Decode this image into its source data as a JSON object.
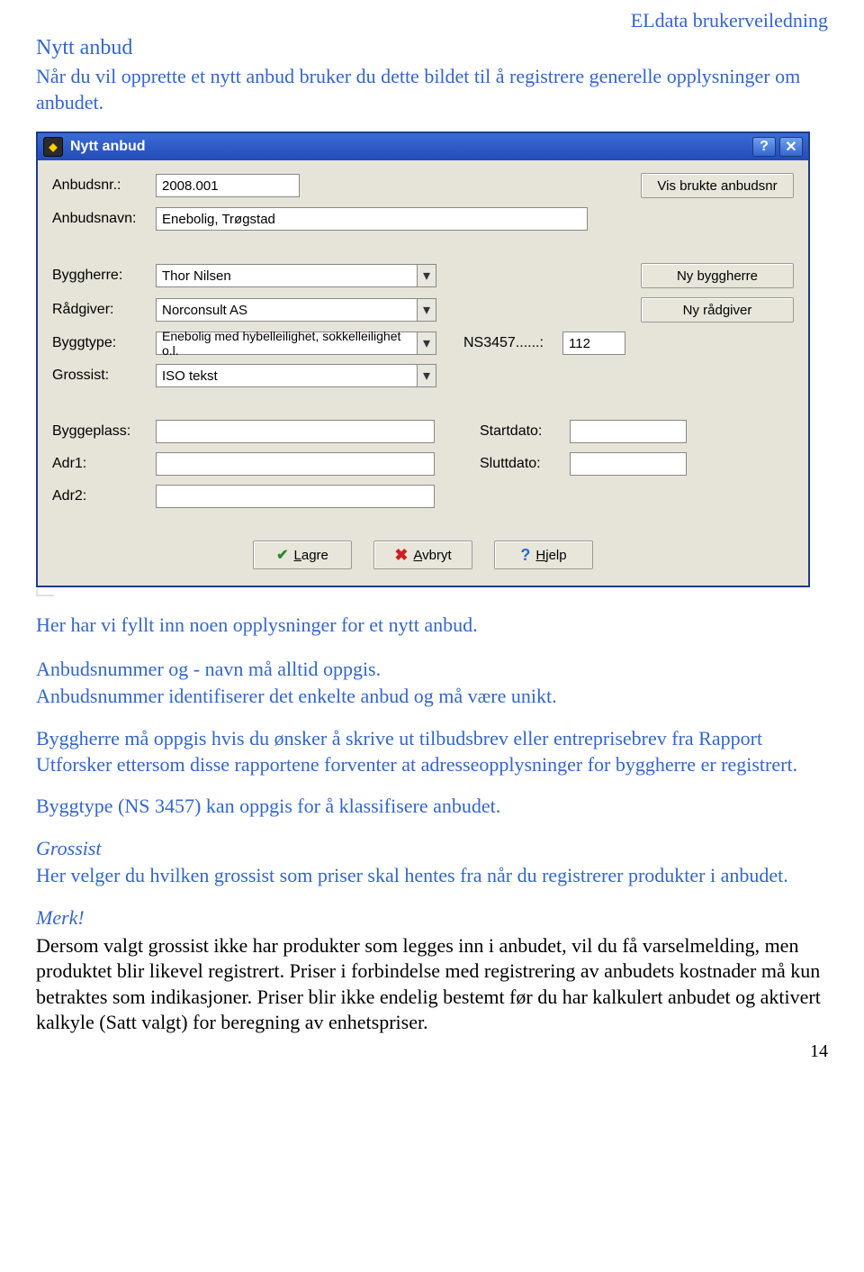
{
  "header": {
    "brand": "ELdata brukerveiledning"
  },
  "doc": {
    "title": "Nytt anbud",
    "intro": "Når du vil opprette et nytt anbud bruker du dette bildet til å registrere generelle opplysninger om anbudet.",
    "p1": "Her har vi fyllt inn noen opplysninger for et nytt anbud.",
    "p2": "Anbudsnummer og - navn må alltid oppgis.",
    "p3": "Anbudsnummer identifiserer det enkelte anbud og må være unikt.",
    "p4": "Byggherre må oppgis hvis du ønsker å skrive ut tilbudsbrev eller entreprisebrev fra Rapport Utforsker ettersom disse rapportene forventer at adresseopplysninger for byggherre er registrert.",
    "p5": "Byggtype (NS 3457) kan oppgis for å klassifisere anbudet.",
    "grossist_h": "Grossist",
    "p6": "Her velger du hvilken grossist som priser skal hentes fra når du registrerer produkter i anbudet.",
    "merk": "Merk!",
    "p7": "Dersom valgt grossist ikke har produkter som legges inn i anbudet, vil du få varselmelding, men produktet blir likevel registrert. Priser i forbindelse med registrering av anbudets kostnader må kun betraktes som indikasjoner. Priser blir ikke endelig bestemt før du har kalkulert anbudet og aktivert kalkyle (Satt valgt) for beregning av enhetspriser.",
    "pagenum": "14"
  },
  "dialog": {
    "title": "Nytt anbud",
    "labels": {
      "anbudsnr": "Anbudsnr.:",
      "anbudsnavn": "Anbudsnavn:",
      "byggherre": "Byggherre:",
      "radgiver": "Rådgiver:",
      "byggtype": "Byggtype:",
      "grossist": "Grossist:",
      "ns3457": "NS3457......:",
      "byggeplass": "Byggeplass:",
      "adr1": "Adr1:",
      "adr2": "Adr2:",
      "startdato": "Startdato:",
      "sluttdato": "Sluttdato:"
    },
    "values": {
      "anbudsnr": "2008.001",
      "anbudsnavn": "Enebolig, Trøgstad",
      "byggherre": "Thor Nilsen",
      "radgiver": "Norconsult AS",
      "byggtype": "Enebolig med hybelleilighet, sokkelleilighet o.l.",
      "grossist": "ISO tekst",
      "ns3457": "112",
      "byggeplass": "",
      "adr1": "",
      "adr2": "",
      "startdato": "",
      "sluttdato": ""
    },
    "buttons": {
      "vis_brukte": "Vis brukte anbudsnr",
      "ny_byggherre": "Ny byggherre",
      "ny_radgiver": "Ny rådgiver",
      "lagre": "Lagre",
      "avbryt": "Avbryt",
      "hjelp": "Hjelp"
    }
  }
}
